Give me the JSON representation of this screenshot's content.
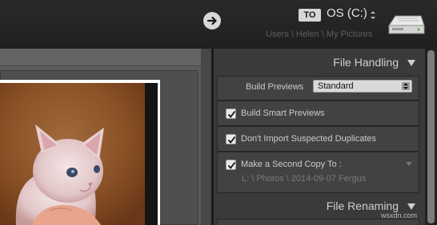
{
  "header": {
    "to_badge": "TO",
    "destination_drive": "OS (C:)",
    "destination_path": "Users \\ Helen \\ My Pictures",
    "icons": [
      "arrow-right-icon",
      "drive-icon",
      "updown-icon"
    ]
  },
  "panel": {
    "file_handling": {
      "title": "File Handling",
      "build_previews_label": "Build Previews",
      "build_previews_value": "Standard",
      "options": [
        {
          "label": "Build Smart Previews",
          "checked": true
        },
        {
          "label": "Don't Import Suspected Duplicates",
          "checked": true
        },
        {
          "label": "Make a Second Copy To :",
          "checked": true
        }
      ],
      "second_copy_path": "L: \\ Photos \\ 2014-09-07 Fergus"
    },
    "file_renaming": {
      "title": "File Renaming"
    }
  },
  "watermark": "wsxdn.com",
  "colors": {
    "background": "#2b2b2b",
    "panel": "#3a3a3a",
    "row": "#424242",
    "text": "#cbcbcb"
  }
}
